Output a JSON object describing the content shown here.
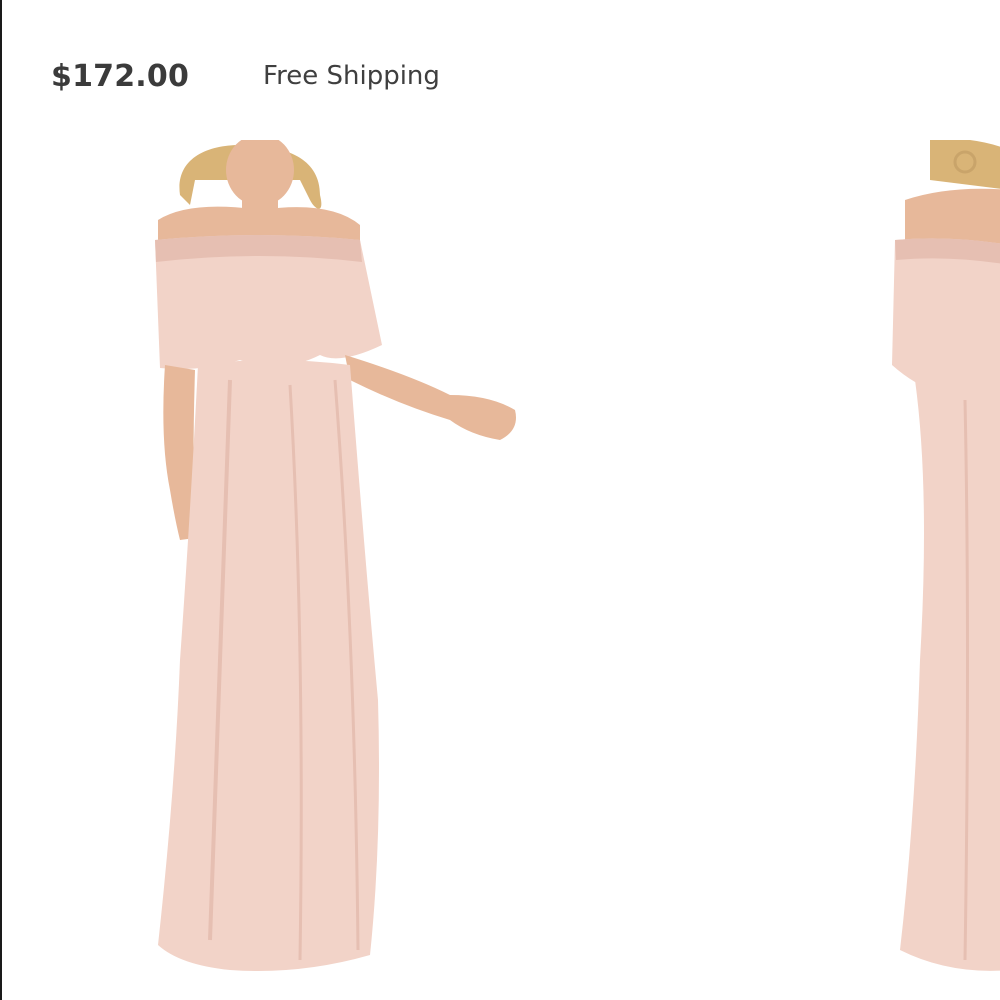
{
  "product": {
    "price": "$172.00",
    "shipping": "Free Shipping"
  },
  "gallery": {
    "images": [
      {
        "subject": "model in blush off-shoulder maxi dress, front view",
        "active": true
      },
      {
        "subject": "model in blush off-shoulder maxi dress, back view",
        "active": false
      }
    ]
  },
  "colors": {
    "dress": "#f2d3c8",
    "dress_shadow": "#e6bfb2",
    "skin": "#e7b89a",
    "hair": "#d9b477",
    "text": "#3f3f3f"
  }
}
